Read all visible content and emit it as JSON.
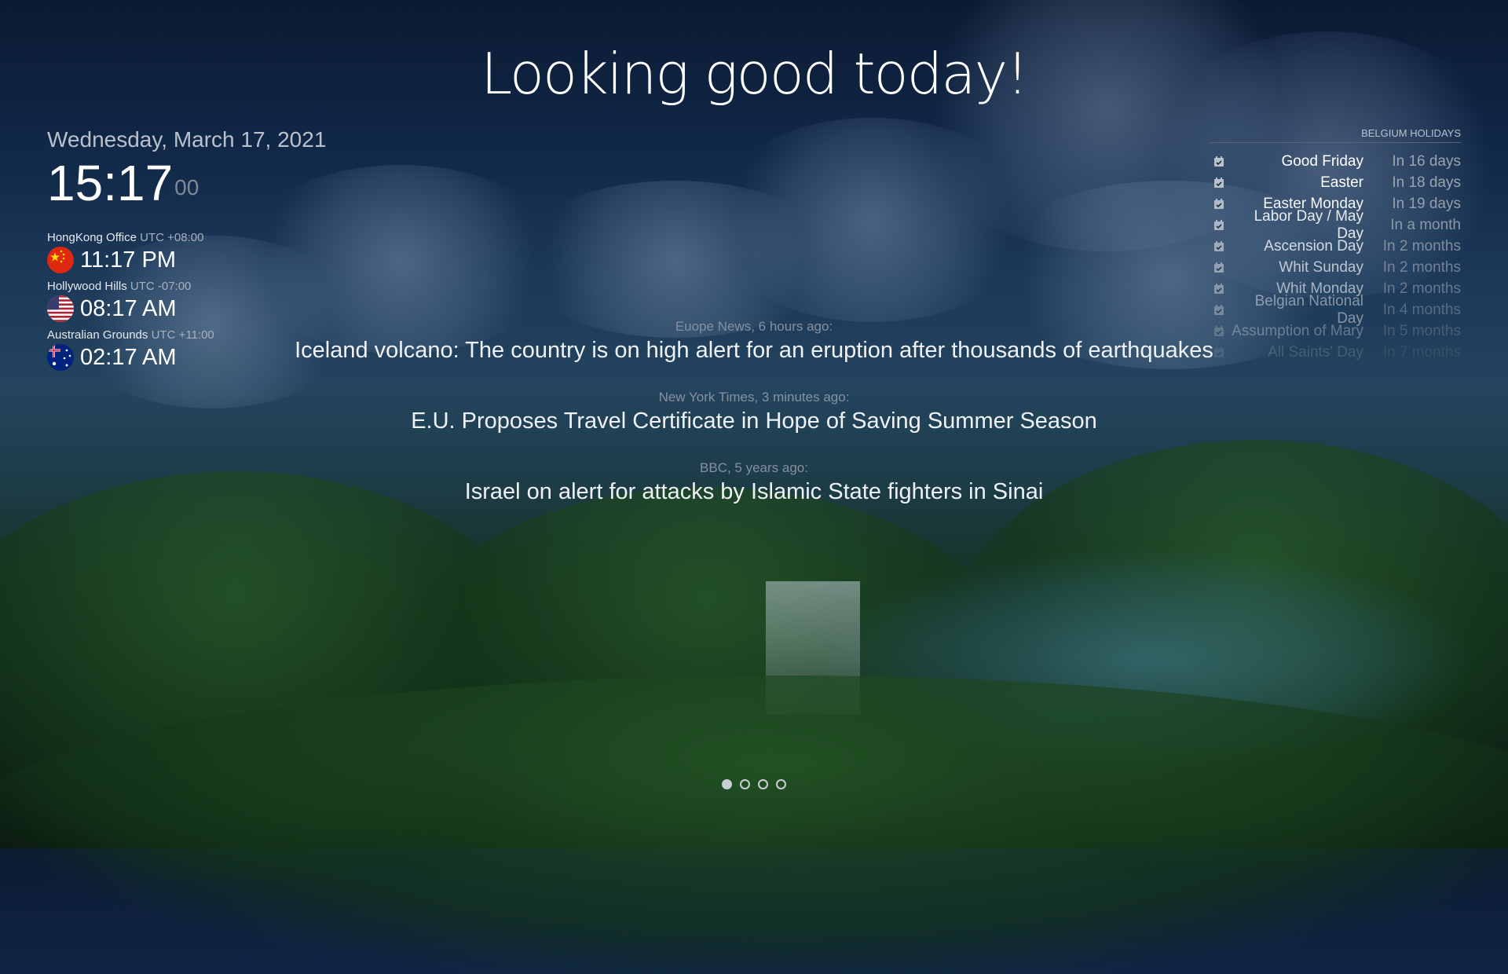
{
  "greeting": "Looking good today!",
  "clock": {
    "date": "Wednesday, March 17, 2021",
    "time": "15:17",
    "seconds": "00"
  },
  "world_clocks": [
    {
      "label": "HongKong Office",
      "offset": "UTC +08:00",
      "time": "11:17 PM",
      "flag": "china-flag-icon"
    },
    {
      "label": "Hollywood Hills",
      "offset": "UTC -07:00",
      "time": "08:17 AM",
      "flag": "usa-flag-icon"
    },
    {
      "label": "Australian Grounds",
      "offset": "UTC +11:00",
      "time": "02:17 AM",
      "flag": "australia-flag-icon"
    }
  ],
  "holidays": {
    "title": "BELGIUM HOLIDAYS",
    "icon": "calendar-icon",
    "items": [
      {
        "name": "Good Friday",
        "when": "In 16 days"
      },
      {
        "name": "Easter",
        "when": "In 18 days"
      },
      {
        "name": "Easter Monday",
        "when": "In 19 days"
      },
      {
        "name": "Labor Day / May Day",
        "when": "In a month"
      },
      {
        "name": "Ascension Day",
        "when": "In 2 months"
      },
      {
        "name": "Whit Sunday",
        "when": "In 2 months"
      },
      {
        "name": "Whit Monday",
        "when": "In 2 months"
      },
      {
        "name": "Belgian National Day",
        "when": "In 4 months"
      },
      {
        "name": "Assumption of Mary",
        "when": "In 5 months"
      },
      {
        "name": "All Saints' Day",
        "when": "In 7 months"
      }
    ]
  },
  "news": [
    {
      "source": "Euope News, 6 hours ago:",
      "headline": "Iceland volcano: The country is on high alert for an eruption after thousands of earthquakes"
    },
    {
      "source": "New York Times, 3 minutes ago:",
      "headline": "E.U. Proposes Travel Certificate in Hope of Saving Summer Season"
    },
    {
      "source": "BBC, 5 years ago:",
      "headline": "Israel on alert for attacks by Islamic State fighters in Sinai"
    }
  ],
  "pager": {
    "pages": 4,
    "active": 1
  }
}
